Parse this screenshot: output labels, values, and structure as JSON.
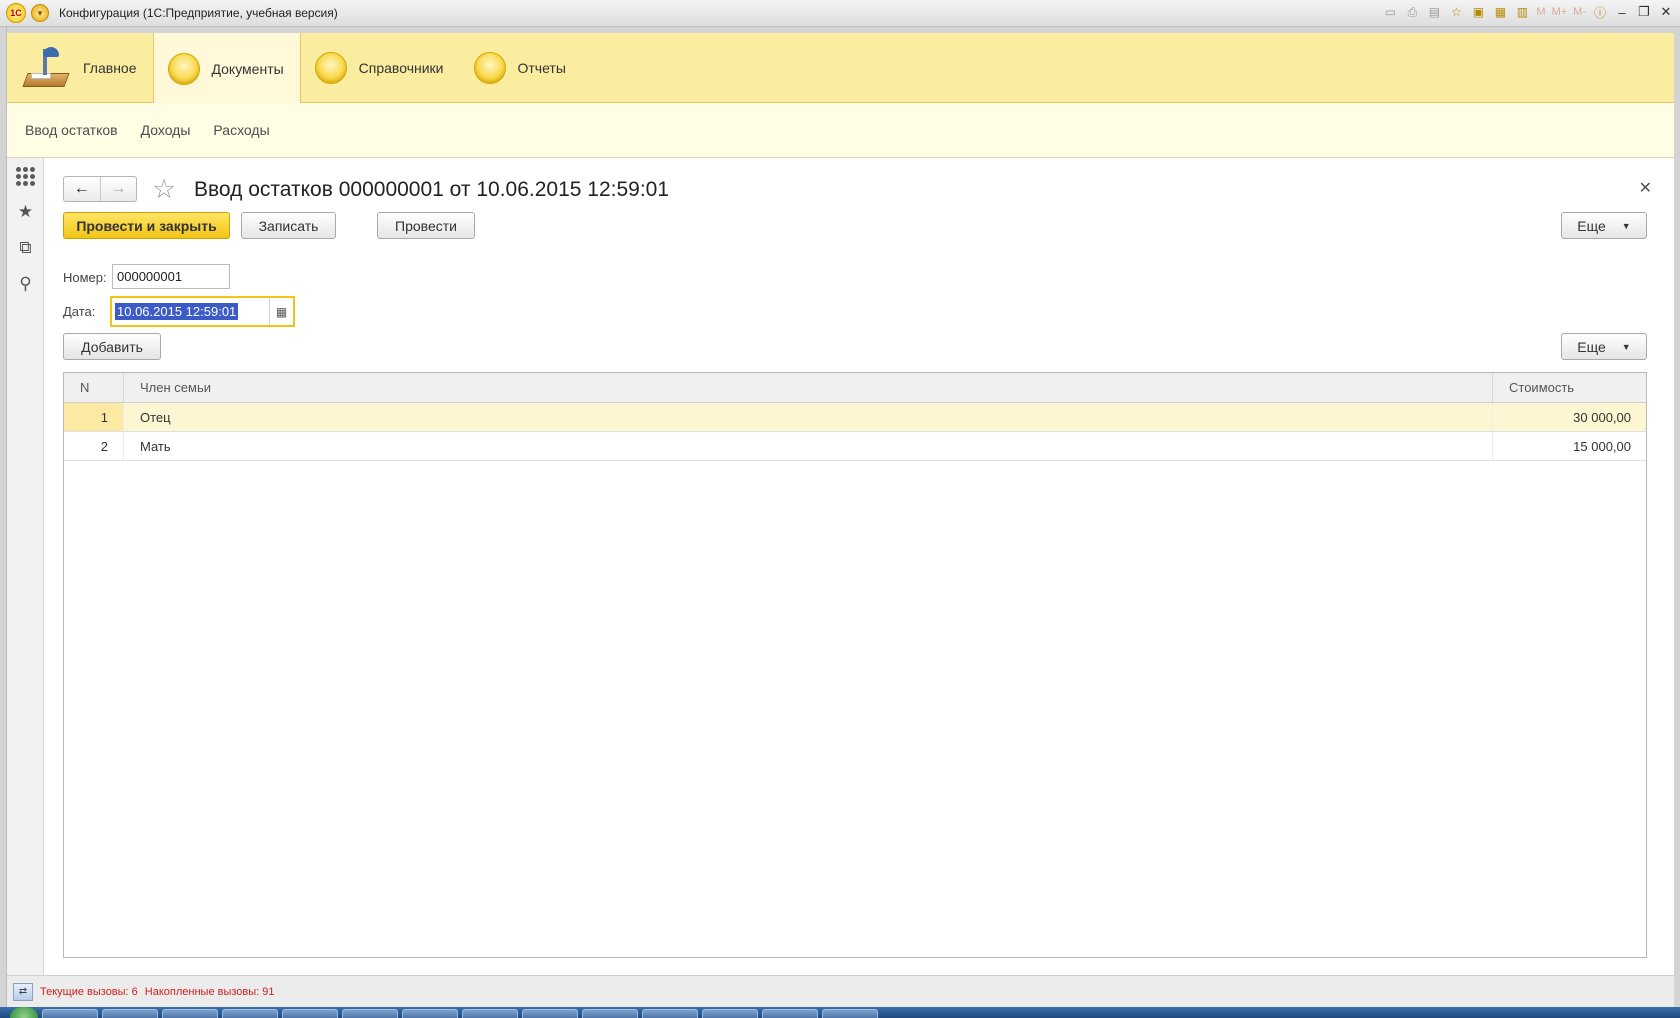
{
  "window": {
    "logo_text": "1С",
    "title": "Конфигурация  (1С:Предприятие, учебная версия)",
    "toolbar_m_labels": [
      "M",
      "M+",
      "M-"
    ]
  },
  "sections": [
    {
      "label": "Главное",
      "icon": "desk-lamp-icon"
    },
    {
      "label": "Документы",
      "icon": "yellow-circle-icon"
    },
    {
      "label": "Справочники",
      "icon": "yellow-circle-icon"
    },
    {
      "label": "Отчеты",
      "icon": "yellow-circle-icon"
    }
  ],
  "subnav": [
    "Ввод остатков",
    "Доходы",
    "Расходы"
  ],
  "form": {
    "title": "Ввод остатков 000000001 от 10.06.2015 12:59:01",
    "post_close_label": "Провести и закрыть",
    "save_label": "Записать",
    "post_label": "Провести",
    "more_label": "Еще",
    "number_label": "Номер:",
    "number_value": "000000001",
    "date_label": "Дата:",
    "date_value": "10.06.2015 12:59:01",
    "add_label": "Добавить"
  },
  "table": {
    "columns": [
      "N",
      "Член семьи",
      "Стоимость"
    ],
    "rows": [
      {
        "n": "1",
        "member": "Отец",
        "cost": "30 000,00"
      },
      {
        "n": "2",
        "member": "Мать",
        "cost": "15 000,00"
      }
    ]
  },
  "status": {
    "current_calls": "Текущие вызовы: 6",
    "accumulated_calls": "Накопленные вызовы: 91"
  },
  "colors": {
    "section_bg": "#fbeda0",
    "subnav_bg": "#fffde4",
    "primary_button": "#f2c416",
    "selected_row": "#fdf6d2",
    "status_text": "#d02020"
  }
}
